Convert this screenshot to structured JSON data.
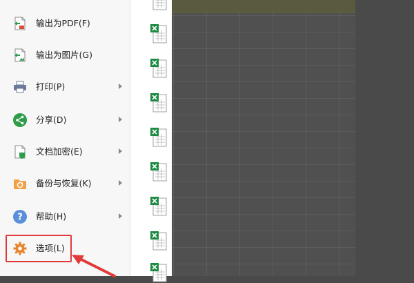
{
  "menu": {
    "items": [
      {
        "label": "输出为PDF(F)",
        "icon": "pdf-export-icon",
        "submenu": false
      },
      {
        "label": "输出为图片(G)",
        "icon": "image-export-icon",
        "submenu": false
      },
      {
        "label": "打印(P)",
        "icon": "printer-icon",
        "submenu": true
      },
      {
        "label": "分享(D)",
        "icon": "share-icon",
        "submenu": true
      },
      {
        "label": "文档加密(E)",
        "icon": "document-lock-icon",
        "submenu": true
      },
      {
        "label": "备份与恢复(K)",
        "icon": "backup-folder-icon",
        "submenu": true
      },
      {
        "label": "帮助(H)",
        "icon": "help-icon",
        "submenu": true
      },
      {
        "label": "选项(L)",
        "icon": "gear-icon",
        "submenu": false
      }
    ]
  },
  "colors": {
    "accent_green": "#2e9d4a",
    "highlight_red": "#e03a3a",
    "options_orange": "#e8842a",
    "help_blue": "#5b8fd9"
  }
}
